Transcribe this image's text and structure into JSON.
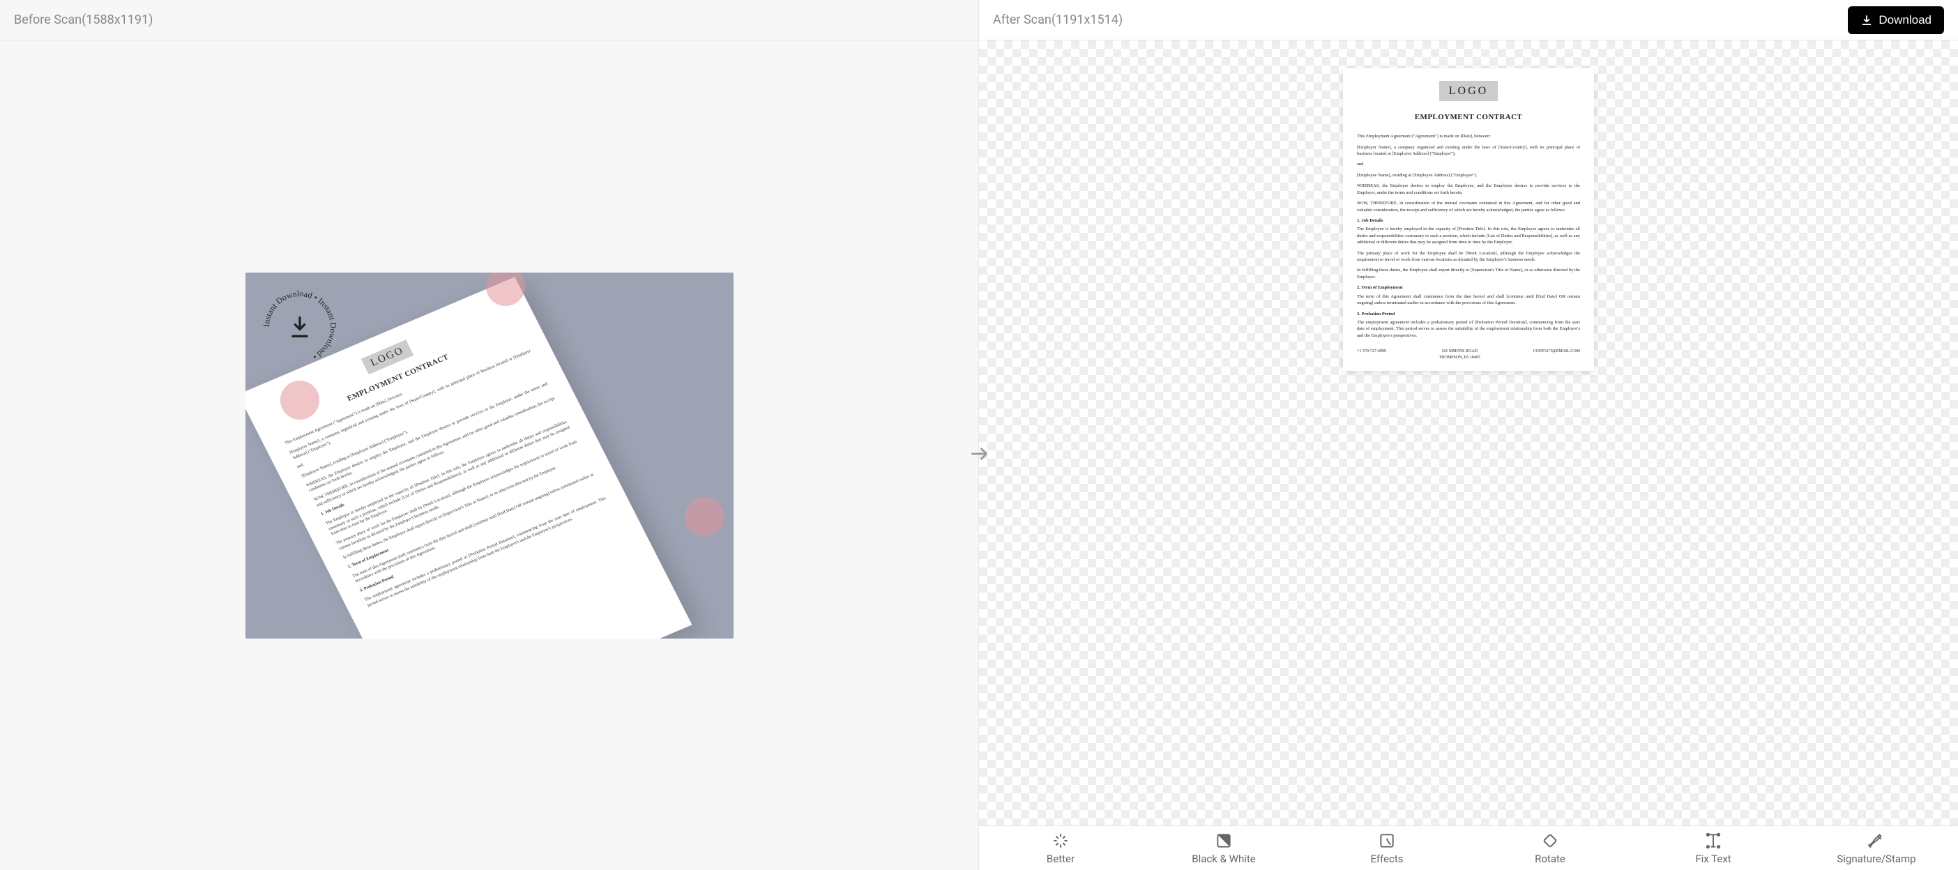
{
  "header": {
    "before_label": "Before Scan(1588x1191)",
    "after_label": "After Scan(1191x1514)",
    "download_label": "Download"
  },
  "badge_text": "Instant Download • Instant Download •",
  "doc": {
    "logo": "LOGO",
    "title": "EMPLOYMENT CONTRACT",
    "p_intro": "This Employment Agreement (\"Agreement\") is made on [Date], between:",
    "p_employer": "[Employer Name], a company organized and existing under the laws of [State/Country], with its principal place of business located at [Employer Address] (\"Employer\"),",
    "p_and": "and",
    "p_employee": "[Employee Name], residing at [Employee Address] (\"Employee\").",
    "p_whereas": "WHEREAS, the Employer desires to employ the Employee, and the Employee desires to provide services to the Employer, under the terms and conditions set forth herein;",
    "p_now": "NOW, THEREFORE, in consideration of the mutual covenants contained in this Agreement, and for other good and valuable consideration, the receipt and sufficiency of which are hereby acknowledged, the parties agree as follows:",
    "s1": "1. Job Details",
    "p_s1a": "The Employee is hereby employed in the capacity of [Position Title]. In this role, the Employee agrees to undertake all duties and responsibilities customary to such a position, which include [List of Duties and Responsibilities], as well as any additional or different duties that may be assigned from time to time by the Employer.",
    "p_s1b": "The primary place of work for the Employee shall be [Work Location], although the Employee acknowledges the requirement to travel or work from various locations as dictated by the Employer's business needs.",
    "p_s1c": "In fulfilling these duties, the Employee shall report directly to [Supervisor's Title or Name], or as otherwise directed by the Employer.",
    "s2": "2. Term of Employment",
    "p_s2": "The term of this Agreement shall commence from the date hereof and shall [continue until [End Date] OR remain ongoing] unless terminated earlier in accordance with the provisions of this Agreement.",
    "s3": "3. Probation Period",
    "p_s3": "The employment agreement includes a probationary period of [Probation Period Duration], commencing from the start date of employment. This period serves to assess the suitability of the employment relationship from both the Employer's and the Employee's perspectives.",
    "footer_phone": "+1 570-727-6999",
    "footer_addr1": "101 SIMONS ROAD",
    "footer_addr2": "THOMPSON, PA 18465",
    "footer_email": "CONTACT@EMAIL.COM"
  },
  "toolbar": [
    {
      "id": "better",
      "label": "Better"
    },
    {
      "id": "bw",
      "label": "Black & White"
    },
    {
      "id": "effects",
      "label": "Effects"
    },
    {
      "id": "rotate",
      "label": "Rotate"
    },
    {
      "id": "fixtext",
      "label": "Fix Text"
    },
    {
      "id": "sigstamp",
      "label": "Signature/Stamp"
    }
  ]
}
